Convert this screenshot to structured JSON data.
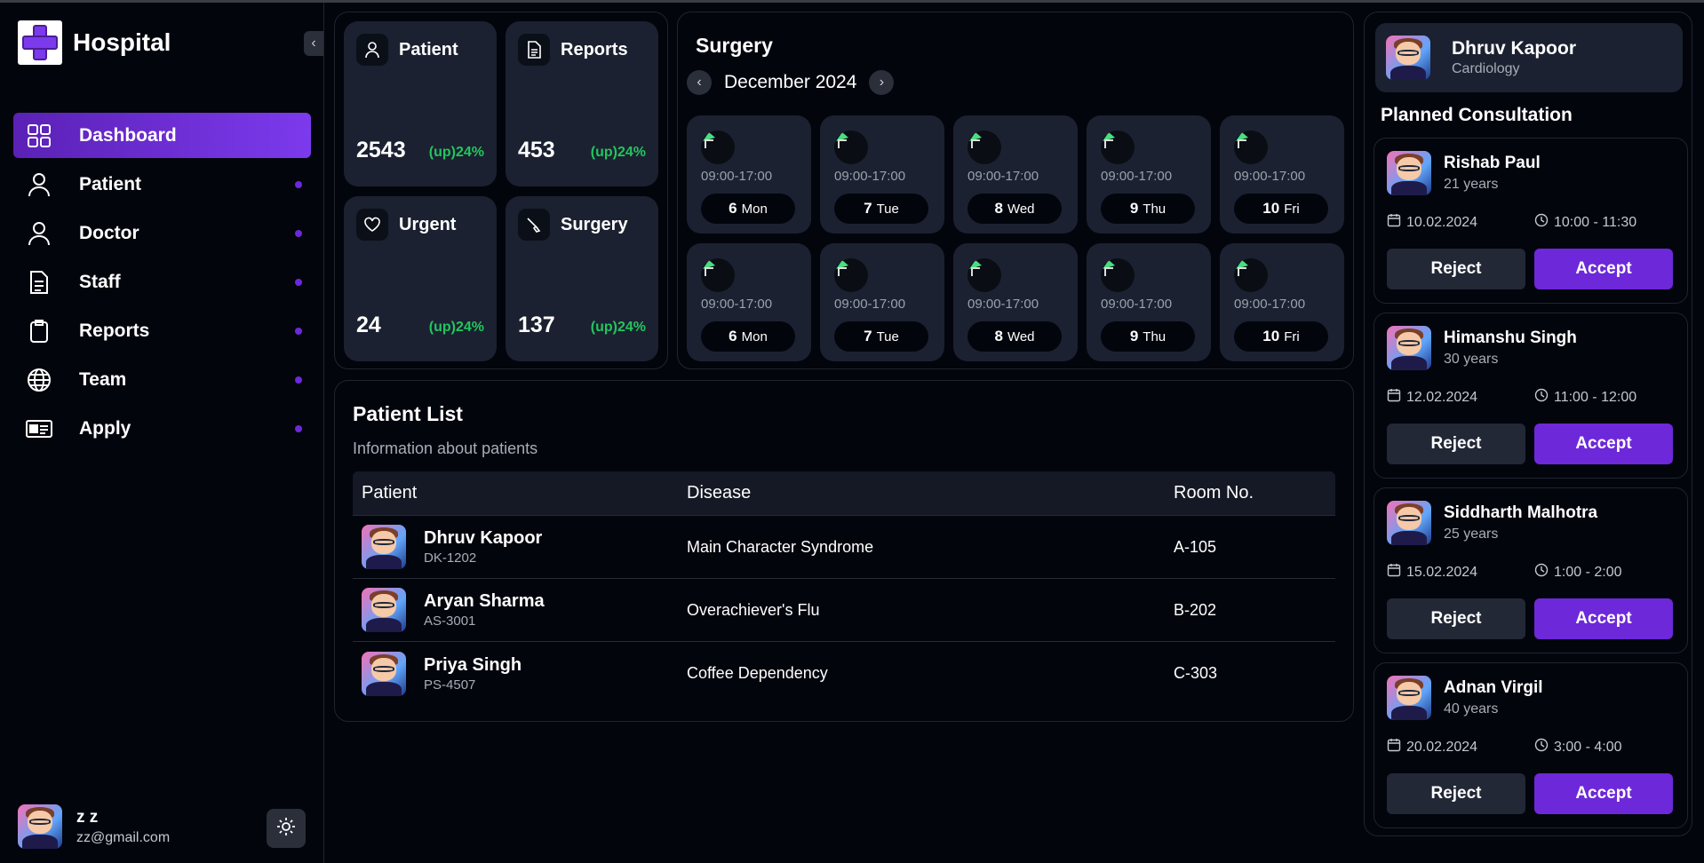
{
  "app": {
    "name": "Hospital"
  },
  "nav": {
    "items": [
      {
        "label": "Dashboard",
        "icon": "grid-icon",
        "active": true
      },
      {
        "label": "Patient",
        "icon": "user-icon"
      },
      {
        "label": "Doctor",
        "icon": "user-icon"
      },
      {
        "label": "Staff",
        "icon": "document-icon"
      },
      {
        "label": "Reports",
        "icon": "clipboard-icon"
      },
      {
        "label": "Team",
        "icon": "globe-icon"
      },
      {
        "label": "Apply",
        "icon": "id-card-icon"
      }
    ]
  },
  "user": {
    "name": "z z",
    "email": "zz@gmail.com"
  },
  "stats": [
    {
      "title": "Patient",
      "value": "2543",
      "change": "(up)24%",
      "icon": "user-icon"
    },
    {
      "title": "Reports",
      "value": "453",
      "change": "(up)24%",
      "icon": "document-icon"
    },
    {
      "title": "Urgent",
      "value": "24",
      "change": "(up)24%",
      "icon": "heart-icon"
    },
    {
      "title": "Surgery",
      "value": "137",
      "change": "(up)24%",
      "icon": "scalpel-icon"
    }
  ],
  "surgery": {
    "title": "Surgery",
    "month": "December 2024",
    "rows": [
      [
        {
          "time": "09:00-17:00",
          "day": "6",
          "weekday": "Mon",
          "img_alt": "image"
        },
        {
          "time": "09:00-17:00",
          "day": "7",
          "weekday": "Tue",
          "img_alt": "image"
        },
        {
          "time": "09:00-17:00",
          "day": "8",
          "weekday": "Wed",
          "img_alt": "image"
        },
        {
          "time": "09:00-17:00",
          "day": "9",
          "weekday": "Thu",
          "img_alt": "image"
        },
        {
          "time": "09:00-17:00",
          "day": "10",
          "weekday": "Fri",
          "img_alt": "image"
        }
      ],
      [
        {
          "time": "09:00-17:00",
          "day": "6",
          "weekday": "Mon",
          "img_alt": "image"
        },
        {
          "time": "09:00-17:00",
          "day": "7",
          "weekday": "Tue",
          "img_alt": "image"
        },
        {
          "time": "09:00-17:00",
          "day": "8",
          "weekday": "Wed",
          "img_alt": "image"
        },
        {
          "time": "09:00-17:00",
          "day": "9",
          "weekday": "Thu",
          "img_alt": "image"
        },
        {
          "time": "09:00-17:00",
          "day": "10",
          "weekday": "Fri",
          "img_alt": "image"
        }
      ]
    ]
  },
  "patient_list": {
    "title": "Patient List",
    "subtitle": "Information about patients",
    "columns": [
      "Patient",
      "Disease",
      "Room No."
    ],
    "rows": [
      {
        "name": "Dhruv Kapoor",
        "id": "DK-1202",
        "disease": "Main Character Syndrome",
        "room": "A-105"
      },
      {
        "name": "Aryan Sharma",
        "id": "AS-3001",
        "disease": "Overachiever's Flu",
        "room": "B-202"
      },
      {
        "name": "Priya Singh",
        "id": "PS-4507",
        "disease": "Coffee Dependency",
        "room": "C-303"
      }
    ]
  },
  "doctor": {
    "name": "Dhruv Kapoor",
    "specialty": "Cardiology"
  },
  "consultations": {
    "title": "Planned Consultation",
    "reject_label": "Reject",
    "accept_label": "Accept",
    "items": [
      {
        "name": "Rishab Paul",
        "age": "21 years",
        "date": "10.02.2024",
        "time": "10:00 - 11:30"
      },
      {
        "name": "Himanshu Singh",
        "age": "30 years",
        "date": "12.02.2024",
        "time": "11:00 - 12:00"
      },
      {
        "name": "Siddharth Malhotra",
        "age": "25 years",
        "date": "15.02.2024",
        "time": "1:00 - 2:00"
      },
      {
        "name": "Adnan Virgil",
        "age": "40 years",
        "date": "20.02.2024",
        "time": "3:00 - 4:00"
      }
    ]
  },
  "colors": {
    "accent": "#6d28d9",
    "positive": "#22c55e",
    "card": "#1b2130",
    "background": "#03050d"
  }
}
